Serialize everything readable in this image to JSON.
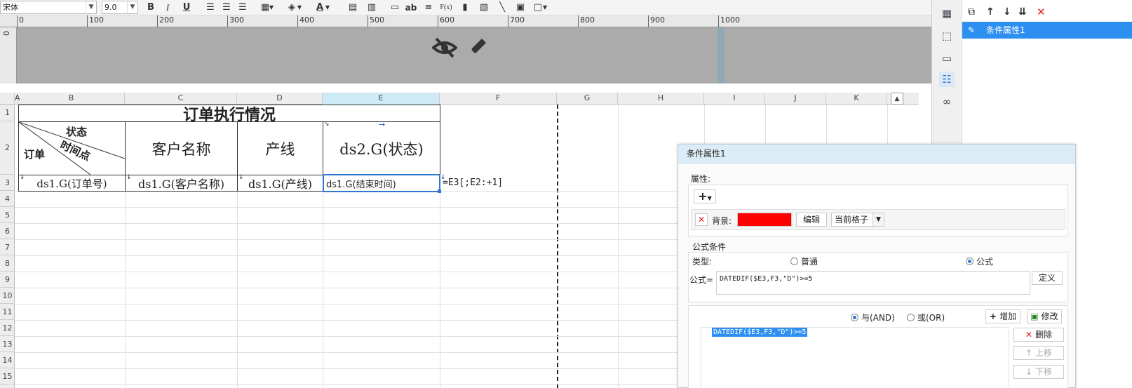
{
  "toolbar": {
    "font_name": "宋体",
    "font_size": "9.0",
    "bold": "B",
    "italic": "I",
    "underline": "U",
    "text_icon": "ab",
    "formula_icon": "F(x)"
  },
  "ruler": {
    "ticks": [
      "0",
      "100",
      "200",
      "300",
      "400",
      "500",
      "600",
      "700",
      "800",
      "900",
      "1000"
    ],
    "left_label": "0"
  },
  "columns": [
    "A",
    "B",
    "C",
    "D",
    "E",
    "F",
    "G",
    "H",
    "I",
    "J",
    "K"
  ],
  "rows": [
    "1",
    "2",
    "3",
    "4",
    "5",
    "6",
    "7",
    "8",
    "9",
    "10",
    "11",
    "12",
    "13",
    "14",
    "15"
  ],
  "sheet": {
    "title": "订单执行情况",
    "diag_top": "状态",
    "diag_mid": "时间点",
    "diag_left": "订单",
    "col_customer": "客户名称",
    "col_line": "产线",
    "col_status": "ds2.G(状态)",
    "r3_b": "ds1.G(订单号)",
    "r3_c": "ds1.G(客户名称)",
    "r3_d": "ds1.G(产线)",
    "r3_e": "ds1.G(结束时间)",
    "r3_f": "=E3[;E2:+1]"
  },
  "prop_panel": {
    "item": "条件属性1"
  },
  "dialog": {
    "title": "条件属性1",
    "attr_label": "属性:",
    "add_icon": "+",
    "bg_label": "背景:",
    "bg_color": "#ff0000",
    "edit_btn": "编辑",
    "scope_select": "当前格子",
    "formula_cond_label": "公式条件",
    "type_label": "类型:",
    "type_normal": "普通",
    "type_formula": "公式",
    "formula_label": "公式=",
    "formula_value": "DATEDIF($E3,F3,\"D\")>=5",
    "define_btn": "定义",
    "and_label": "与(AND)",
    "or_label": "或(OR)",
    "add_btn": "增加",
    "modify_btn": "修改",
    "list_item": "DATEDIF($E3,F3,\"D\")>=5",
    "delete_btn": "删除",
    "up_btn": "上移",
    "down_btn": "下移"
  }
}
